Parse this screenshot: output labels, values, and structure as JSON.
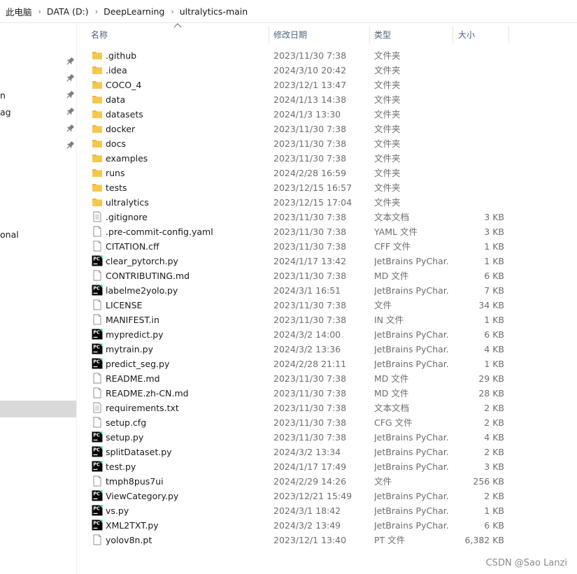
{
  "breadcrumb": [
    "此电脑",
    "DATA (D:)",
    "DeepLearning",
    "ultralytics-main"
  ],
  "nav": {
    "partial_labels": [
      "n",
      "ag",
      "onal"
    ],
    "pinned_count": 6
  },
  "columns": {
    "name": "名称",
    "date": "修改日期",
    "type": "类型",
    "size": "大小"
  },
  "icon_types": {
    "folder": "folder-icon",
    "file": "file-icon",
    "text": "text-file-icon",
    "pycharm": "pycharm-file-icon"
  },
  "files": [
    {
      "name": ".github",
      "date": "2023/11/30 7:38",
      "type": "文件夹",
      "size": "",
      "icon": "folder"
    },
    {
      "name": ".idea",
      "date": "2024/3/10 20:42",
      "type": "文件夹",
      "size": "",
      "icon": "folder"
    },
    {
      "name": "COCO_4",
      "date": "2023/12/1 13:47",
      "type": "文件夹",
      "size": "",
      "icon": "folder"
    },
    {
      "name": "data",
      "date": "2024/1/13 14:38",
      "type": "文件夹",
      "size": "",
      "icon": "folder"
    },
    {
      "name": "datasets",
      "date": "2024/1/3 13:30",
      "type": "文件夹",
      "size": "",
      "icon": "folder"
    },
    {
      "name": "docker",
      "date": "2023/11/30 7:38",
      "type": "文件夹",
      "size": "",
      "icon": "folder"
    },
    {
      "name": "docs",
      "date": "2023/11/30 7:38",
      "type": "文件夹",
      "size": "",
      "icon": "folder"
    },
    {
      "name": "examples",
      "date": "2023/11/30 7:38",
      "type": "文件夹",
      "size": "",
      "icon": "folder"
    },
    {
      "name": "runs",
      "date": "2024/2/28 16:59",
      "type": "文件夹",
      "size": "",
      "icon": "folder"
    },
    {
      "name": "tests",
      "date": "2023/12/15 16:57",
      "type": "文件夹",
      "size": "",
      "icon": "folder"
    },
    {
      "name": "ultralytics",
      "date": "2023/12/15 17:04",
      "type": "文件夹",
      "size": "",
      "icon": "folder"
    },
    {
      "name": ".gitignore",
      "date": "2023/11/30 7:38",
      "type": "文本文档",
      "size": "3 KB",
      "icon": "text"
    },
    {
      "name": ".pre-commit-config.yaml",
      "date": "2023/11/30 7:38",
      "type": "YAML 文件",
      "size": "3 KB",
      "icon": "file"
    },
    {
      "name": "CITATION.cff",
      "date": "2023/11/30 7:38",
      "type": "CFF 文件",
      "size": "1 KB",
      "icon": "file"
    },
    {
      "name": "clear_pytorch.py",
      "date": "2024/1/17 13:42",
      "type": "JetBrains PyChar...",
      "size": "1 KB",
      "icon": "pycharm"
    },
    {
      "name": "CONTRIBUTING.md",
      "date": "2023/11/30 7:38",
      "type": "MD 文件",
      "size": "6 KB",
      "icon": "file"
    },
    {
      "name": "labelme2yolo.py",
      "date": "2024/3/1 16:51",
      "type": "JetBrains PyChar...",
      "size": "7 KB",
      "icon": "pycharm"
    },
    {
      "name": "LICENSE",
      "date": "2023/11/30 7:38",
      "type": "文件",
      "size": "34 KB",
      "icon": "file"
    },
    {
      "name": "MANIFEST.in",
      "date": "2023/11/30 7:38",
      "type": "IN 文件",
      "size": "1 KB",
      "icon": "file"
    },
    {
      "name": "mypredict.py",
      "date": "2024/3/2 14:00",
      "type": "JetBrains PyChar...",
      "size": "6 KB",
      "icon": "pycharm"
    },
    {
      "name": "mytrain.py",
      "date": "2024/3/2 13:36",
      "type": "JetBrains PyChar...",
      "size": "4 KB",
      "icon": "pycharm"
    },
    {
      "name": "predict_seg.py",
      "date": "2024/2/28 21:11",
      "type": "JetBrains PyChar...",
      "size": "1 KB",
      "icon": "pycharm"
    },
    {
      "name": "README.md",
      "date": "2023/11/30 7:38",
      "type": "MD 文件",
      "size": "29 KB",
      "icon": "file"
    },
    {
      "name": "README.zh-CN.md",
      "date": "2023/11/30 7:38",
      "type": "MD 文件",
      "size": "28 KB",
      "icon": "file"
    },
    {
      "name": "requirements.txt",
      "date": "2023/11/30 7:38",
      "type": "文本文档",
      "size": "2 KB",
      "icon": "text"
    },
    {
      "name": "setup.cfg",
      "date": "2023/11/30 7:38",
      "type": "CFG 文件",
      "size": "2 KB",
      "icon": "file"
    },
    {
      "name": "setup.py",
      "date": "2023/11/30 7:38",
      "type": "JetBrains PyChar...",
      "size": "4 KB",
      "icon": "pycharm"
    },
    {
      "name": "splitDataset.py",
      "date": "2024/3/2 13:34",
      "type": "JetBrains PyChar...",
      "size": "2 KB",
      "icon": "pycharm"
    },
    {
      "name": "test.py",
      "date": "2024/1/17 17:49",
      "type": "JetBrains PyChar...",
      "size": "3 KB",
      "icon": "pycharm"
    },
    {
      "name": "tmph8pus7ui",
      "date": "2024/2/29 14:26",
      "type": "文件",
      "size": "256 KB",
      "icon": "file"
    },
    {
      "name": "ViewCategory.py",
      "date": "2023/12/21 15:49",
      "type": "JetBrains PyChar...",
      "size": "2 KB",
      "icon": "pycharm"
    },
    {
      "name": "vs.py",
      "date": "2024/3/1 18:42",
      "type": "JetBrains PyChar...",
      "size": "1 KB",
      "icon": "pycharm"
    },
    {
      "name": "XML2TXT.py",
      "date": "2024/3/2 13:49",
      "type": "JetBrains PyChar...",
      "size": "6 KB",
      "icon": "pycharm"
    },
    {
      "name": "yolov8n.pt",
      "date": "2023/12/1 13:40",
      "type": "PT 文件",
      "size": "6,382 KB",
      "icon": "file"
    }
  ],
  "watermark": "CSDN @Sao Lanzi",
  "colors": {
    "folder": "#f5c84c",
    "pycharm_bg": "#0e7a5c",
    "header_text": "#4c607a",
    "selected_nav": "#d9d9d9"
  }
}
